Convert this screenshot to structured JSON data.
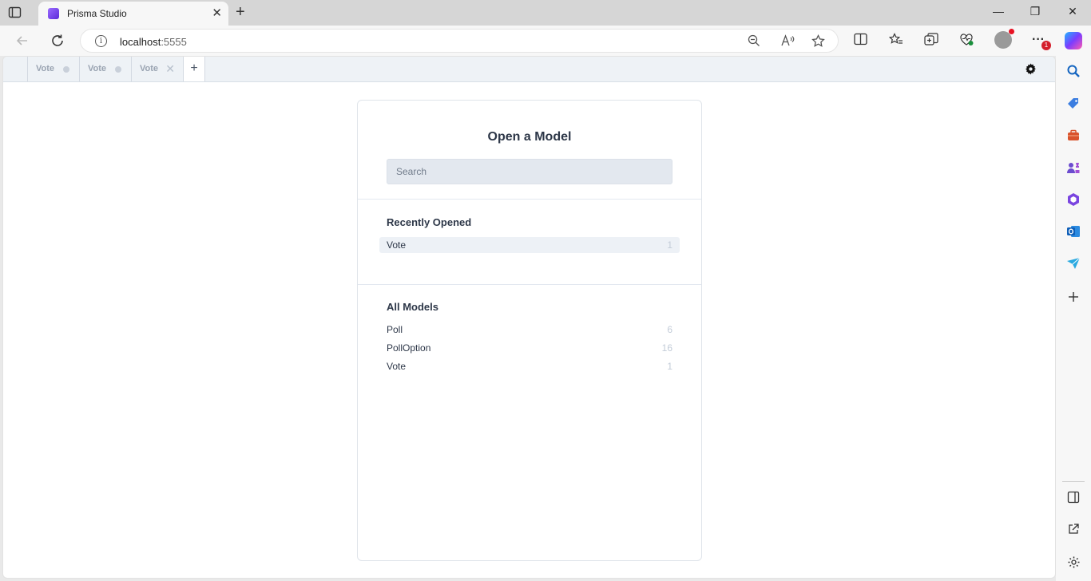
{
  "browser": {
    "tab_title": "Prisma Studio",
    "tab_close": "✕",
    "new_tab": "+",
    "minimize": "—",
    "restore": "❐",
    "close": "✕",
    "url_host": "localhost",
    "url_port": ":5555",
    "info": "i",
    "notification_badge": "1",
    "more": "···"
  },
  "studio": {
    "tabs": [
      {
        "label": "Vote",
        "state": "dot"
      },
      {
        "label": "Vote",
        "state": "dot"
      },
      {
        "label": "Vote",
        "state": "close"
      }
    ],
    "tab_close_glyph": "✕",
    "add_tab": "+"
  },
  "picker": {
    "title": "Open a Model",
    "search_placeholder": "Search",
    "recent_title": "Recently Opened",
    "recent": [
      {
        "name": "Vote",
        "count": "1"
      }
    ],
    "all_title": "All Models",
    "models": [
      {
        "name": "Poll",
        "count": "6"
      },
      {
        "name": "PollOption",
        "count": "16"
      },
      {
        "name": "Vote",
        "count": "1"
      }
    ]
  },
  "colors": {
    "accent": "#2d3748",
    "tabbar": "#eef2f6",
    "search_bg": "#e3e8ef",
    "count": "#c3ccd8"
  }
}
